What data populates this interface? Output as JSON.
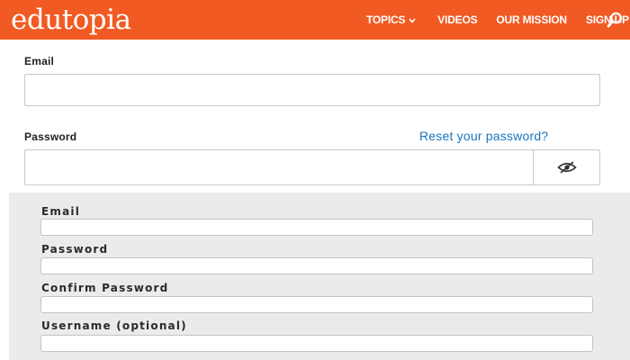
{
  "header": {
    "logo": "edutopia",
    "nav": [
      {
        "label": "TOPICS"
      },
      {
        "label": "VIDEOS"
      },
      {
        "label": "OUR MISSION"
      },
      {
        "label": "SIGN UP"
      }
    ],
    "brand_color": "#f15a22"
  },
  "login": {
    "email_label": "Email",
    "email_value": "",
    "password_label": "Password",
    "password_value": "",
    "reset_link": "Reset your password?"
  },
  "signup": {
    "email_label": "Email",
    "password_label": "Password",
    "confirm_label": "Confirm Password",
    "username_label": "Username (optional)"
  },
  "icons": {
    "search": "search-icon",
    "eye": "eye-slash-icon",
    "chevron": "chevron-down-icon"
  },
  "colors": {
    "link": "#1b75bb",
    "panel": "#ebebeb"
  }
}
